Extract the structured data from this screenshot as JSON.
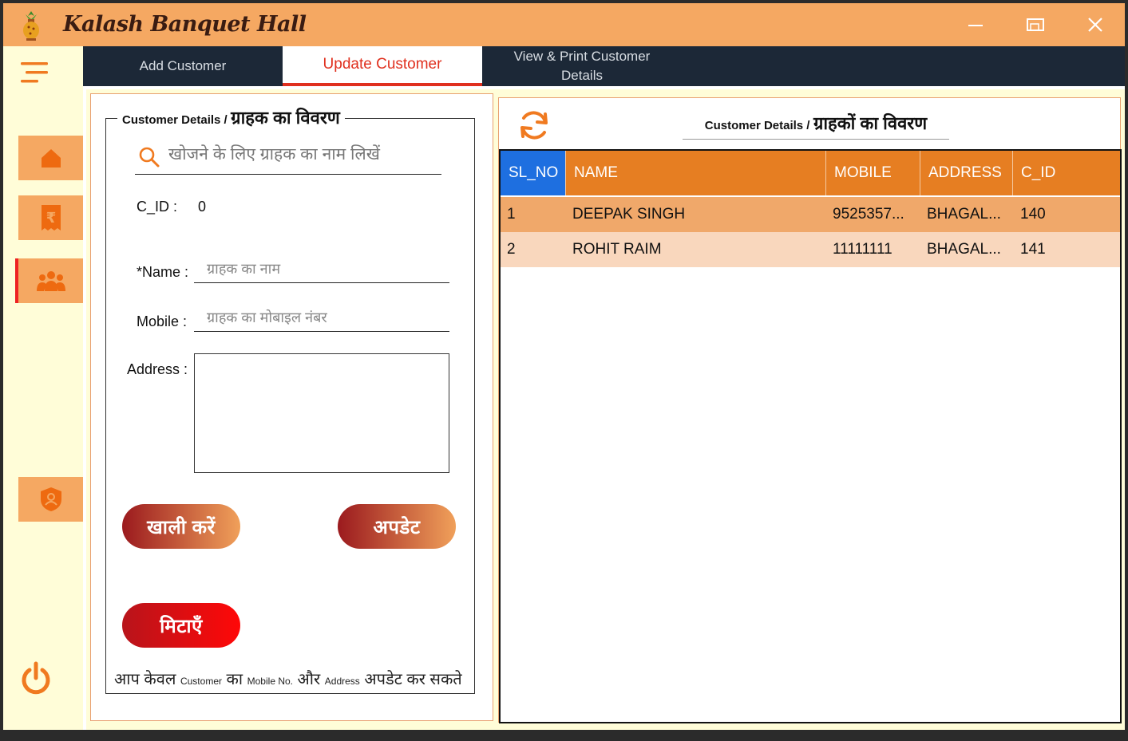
{
  "app": {
    "title": "Kalash Banquet Hall"
  },
  "tabs": [
    {
      "label": "Add Customer",
      "active": false
    },
    {
      "label": "Update Customer",
      "active": true
    },
    {
      "label_line1": "View & Print Customer",
      "label_line2": "Details",
      "active": false
    }
  ],
  "sidebar": {
    "items": [
      {
        "icon": "home-icon"
      },
      {
        "icon": "rupee-receipt-icon"
      },
      {
        "icon": "customers-icon",
        "active": true
      },
      {
        "icon": "admin-shield-icon"
      },
      {
        "icon": "power-icon"
      }
    ]
  },
  "form": {
    "legend_en": "Customer Details /",
    "legend_hi": "ग्राहक का विवरण",
    "search_placeholder": "खोजने के लिए ग्राहक का नाम  लिखें",
    "cid_label": "C_ID :",
    "cid_value": "0",
    "name_label": "*Name :",
    "name_placeholder": "ग्राहक का नाम",
    "mobile_label": "Mobile :",
    "mobile_placeholder": "ग्राहक का मोबाइल नंबर",
    "address_label": "Address :",
    "clear_button": "खाली करें",
    "update_button": "अपडेट",
    "delete_button": "मिटाएँ",
    "note": {
      "p1": "आप केवल ",
      "p2": "Customer",
      "p3": " का ",
      "p4": "Mobile No.",
      "p5": " और ",
      "p6": "Address",
      "p7": " अपडेट कर सकते"
    }
  },
  "table": {
    "title_en": "Customer Details /",
    "title_hi": "ग्राहकों का विवरण",
    "columns": [
      "SL_NO",
      "NAME",
      "MOBILE",
      "ADDRESS",
      "C_ID"
    ],
    "rows": [
      {
        "sl": "1",
        "name": "DEEPAK SINGH",
        "mobile": "9525357...",
        "address": "BHAGAL...",
        "cid": "140"
      },
      {
        "sl": "2",
        "name": "ROHIT RAIM",
        "mobile": "11111111",
        "address": "BHAGAL...",
        "cid": "141"
      }
    ]
  },
  "colors": {
    "accent": "#f5a862",
    "header": "#e67e22",
    "tabbar": "#1c2837",
    "active_tab": "#e0301e",
    "selected_header": "#1e6fe0"
  }
}
